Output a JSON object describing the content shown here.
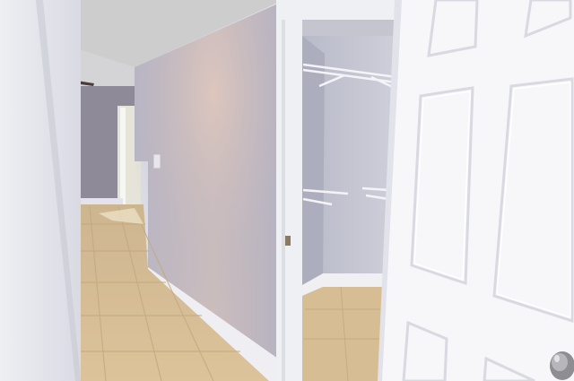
{
  "scene": {
    "colors": {
      "wall_lavender": "#b9b9c9",
      "wall_lit": "#d6c9c6",
      "ceiling": "#cfcfcf",
      "tile": "#d8bf92",
      "tile_grout": "#c9ad7e",
      "trim_white": "#f0f0f2",
      "door_white": "#f7f7f9",
      "closet_wall": "#c6c7d3",
      "far_wall": "#8f8a96"
    },
    "icons": [
      "ceiling-fan-icon",
      "light-switch-icon",
      "door-knob-icon",
      "wire-shelf-icon"
    ],
    "watermark_text": ""
  }
}
